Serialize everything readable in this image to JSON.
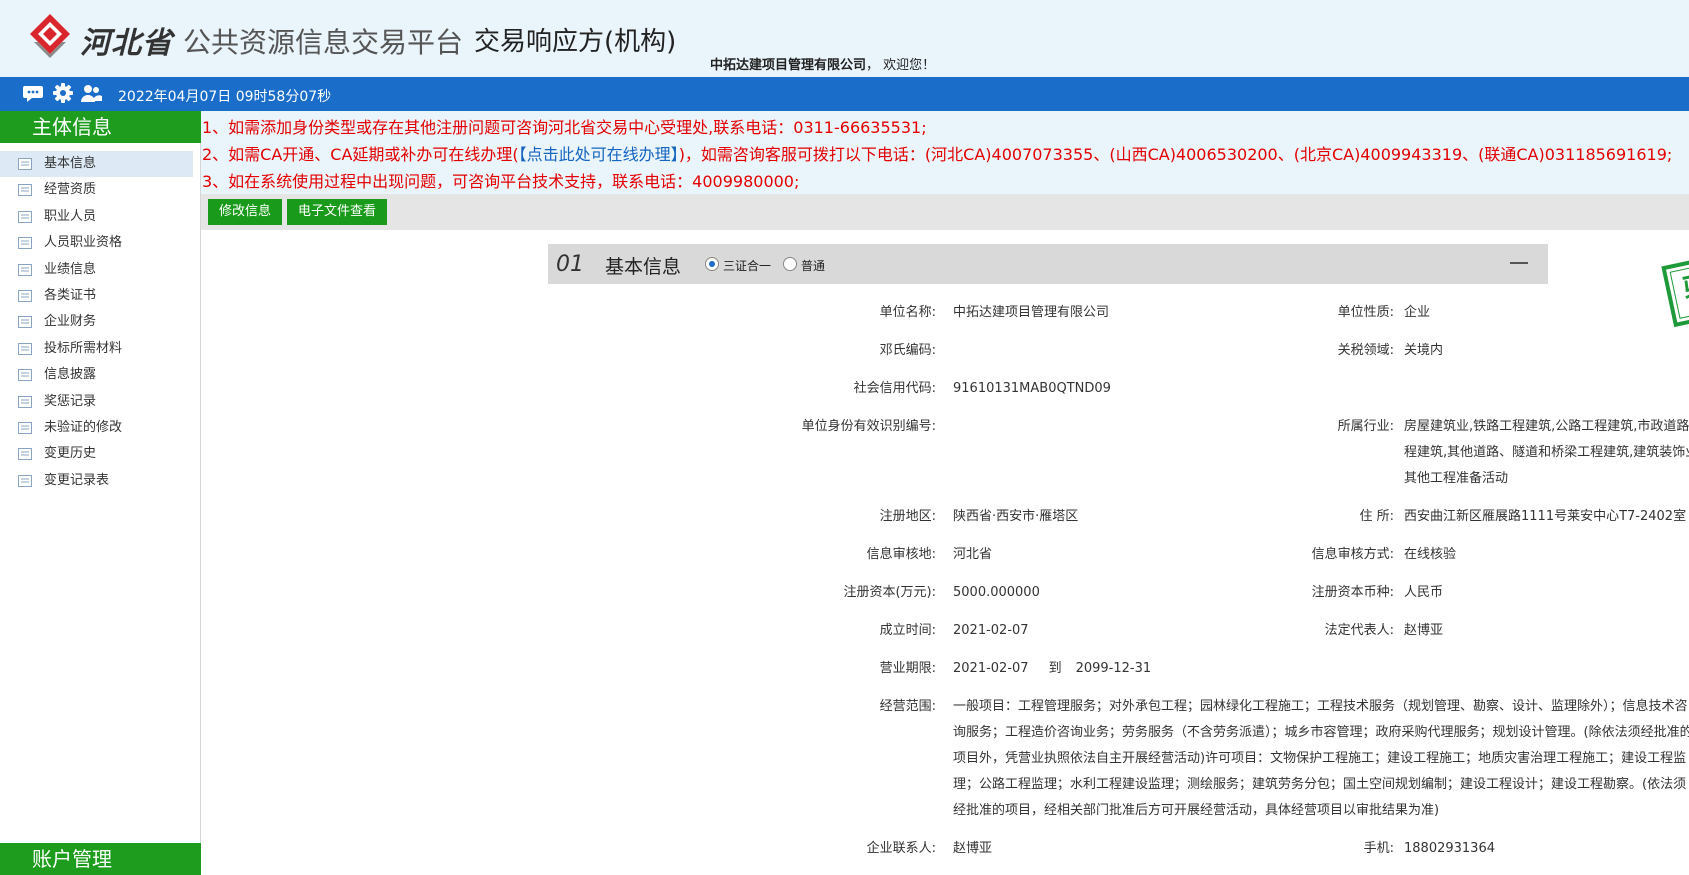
{
  "header": {
    "province": "河北省",
    "platform": "公共资源信息交易平台",
    "role": "交易响应方(机构)",
    "company": "中拓达建项目管理有限公司",
    "welcome": "， 欢迎您！"
  },
  "topbar": {
    "datetime": "2022年04月07日 09时58分07秒"
  },
  "sidebar": {
    "main_heading": "主体信息",
    "items": [
      {
        "label": "基本信息"
      },
      {
        "label": "经营资质"
      },
      {
        "label": "职业人员"
      },
      {
        "label": "人员职业资格"
      },
      {
        "label": "业绩信息"
      },
      {
        "label": "各类证书"
      },
      {
        "label": "企业财务"
      },
      {
        "label": "投标所需材料"
      },
      {
        "label": "信息披露"
      },
      {
        "label": "奖惩记录"
      },
      {
        "label": "未验证的修改"
      },
      {
        "label": "变更历史"
      },
      {
        "label": "变更记录表"
      }
    ],
    "account_heading": "账户管理"
  },
  "notice": {
    "line1": "1、如需添加身份类型或存在其他注册问题可咨询河北省交易中心受理处,联系电话：0311-66635531;",
    "line2_pre": "2、如需CA开通、CA延期或补办可在线办理(",
    "line2_link": "【点击此处可在线办理】",
    "line2_post": ")，如需咨询客服可拨打以下电话：(河北CA)4007073355、(山西CA)4006530200、(北京CA)4009943319、(联通CA)031185691619;",
    "line3": "3、如在系统使用过程中出现问题，可咨询平台技术支持，联系电话：4009980000;"
  },
  "actions": {
    "edit": "修改信息",
    "files": "电子文件查看"
  },
  "section": {
    "number": "01",
    "title": "基本信息",
    "radio1": "三证合一",
    "radio2": "普通",
    "stamp": "验证通过"
  },
  "fields": {
    "unit_name_label": "单位名称:",
    "unit_name": "中拓达建项目管理有限公司",
    "unit_type_label": "单位性质:",
    "unit_type": "企业",
    "duns_label": "邓氏编码:",
    "duns": "",
    "customs_label": "关税领域:",
    "customs": "关境内",
    "credit_code_label": "社会信用代码:",
    "credit_code": "91610131MAB0QTND09",
    "identity_label": "单位身份有效识别编号:",
    "identity": "",
    "industry_label": "所属行业:",
    "industry": "房屋建筑业,铁路工程建筑,公路工程建筑,市政道路工程建筑,其他道路、隧道和桥梁工程建筑,建筑装饰业,其他工程准备活动",
    "region_label": "注册地区:",
    "region": "陕西省·西安市·雁塔区",
    "address_label": "住 所:",
    "address": "西安曲江新区雁展路1111号莱安中心T7-2402室",
    "review_place_label": "信息审核地:",
    "review_place": "河北省",
    "review_method_label": "信息审核方式:",
    "review_method": "在线核验",
    "capital_label": "注册资本(万元):",
    "capital": "5000.000000",
    "currency_label": "注册资本币种:",
    "currency": "人民币",
    "founded_label": "成立时间:",
    "founded": "2021-02-07",
    "legal_rep_label": "法定代表人:",
    "legal_rep": "赵博亚",
    "term_label": "营业期限:",
    "term_start": "2021-02-07",
    "term_to": "到",
    "term_end": "2099-12-31",
    "scope_label": "经营范围:",
    "scope": "一般项目：工程管理服务；对外承包工程；园林绿化工程施工；工程技术服务（规划管理、勘察、设计、监理除外）；信息技术咨询服务；工程造价咨询业务；劳务服务（不含劳务派遣）；城乡市容管理；政府采购代理服务；规划设计管理。(除依法须经批准的项目外，凭营业执照依法自主开展经营活动)许可项目：文物保护工程施工；建设工程施工；地质灾害治理工程施工；建设工程监理；公路工程监理；水利工程建设监理；测绘服务；建筑劳务分包；国土空间规划编制；建设工程设计；建设工程勘察。(依法须经批准的项目，经相关部门批准后方可开展经营活动，具体经营项目以审批结果为准)",
    "contact_label": "企业联系人:",
    "contact": "赵博亚",
    "phone_label": "手机:",
    "phone": "18802931364"
  },
  "colors": {
    "brand_blue": "#1a6dc8",
    "brand_green": "#1e9c1e",
    "notice_red": "#e20000",
    "stamp_green": "#1f9a3a"
  }
}
